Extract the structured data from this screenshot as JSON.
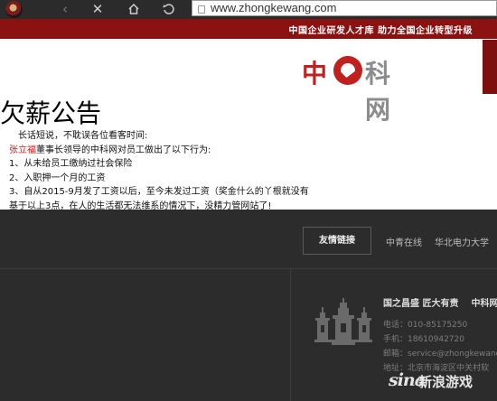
{
  "browser": {
    "url": "www.zhongkewang.com"
  },
  "banner": {
    "text": "中国企业研发人才库 助力全国企业转型升级"
  },
  "logo": {
    "zhong": "中",
    "rest": "科网"
  },
  "notice": {
    "title": "欠薪公告",
    "intro": "长话短说，不耽误各位看客时间:",
    "name": "张立福",
    "after_name": "董事长领导的中科网对员工做出了以下行为:",
    "items": [
      "1、从未给员工缴纳过社会保险",
      "2、入职押一个月的工资",
      "3、自从2015-9月发了工资以后，至今未发过工资（奖金什么的丫根就没有"
    ],
    "conclusion": "基于以上3点，在人的生活都无法维系的情况下，没精力管网站了!"
  },
  "footer": {
    "links_button": "友情链接",
    "links": [
      "中青在线",
      "华北电力大学"
    ],
    "contact_head": [
      "国之昌盛 匠大有责",
      "中科网"
    ],
    "phone": "电话：010-85175250",
    "mobile": "手机：18610942720",
    "email": "邮箱：service@zhongkewang",
    "address": "地址：北京市海淀区中关村软"
  },
  "watermark": {
    "sina": "sina",
    "text": "新浪游戏"
  }
}
